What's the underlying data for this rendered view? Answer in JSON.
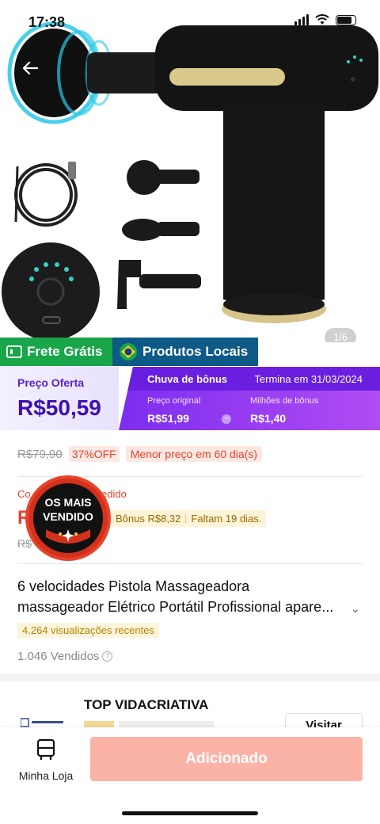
{
  "status_bar": {
    "time": "17:38"
  },
  "gallery": {
    "counter": "1/6"
  },
  "badges": {
    "free_shipping": "Frete Grátis",
    "local_products": "Produtos Locais"
  },
  "price": {
    "offer_label": "Preço Oferta",
    "offer_value": "R$50,59",
    "promo_title": "Chuva de bônus",
    "promo_ends": "Termina em 31/03/2024",
    "original_label": "Preço original",
    "original_value": "R$51,99",
    "bonus_label": "Milhões de bônus",
    "bonus_value": "R$1,40"
  },
  "discount": {
    "old_price": "R$79,90",
    "percent": "37%OFF",
    "lowest": "Menor preço em 60 dia(s)"
  },
  "coupon": {
    "label_prefix": "Co",
    "label_suffix": "edido",
    "price_prefix": "R",
    "bonus": "Bônus R$8,32",
    "remaining": "Faltam 19 dias.",
    "old_prefix": "R$"
  },
  "seal": {
    "line1": "OS MAIS",
    "line2": "VENDIDO"
  },
  "product": {
    "title_line1": "6 velocidades Pistola Massageadora",
    "title_line2": "massageador Elétrico Portátil Profissional apare...",
    "views": "4.264 visualizações recentes",
    "sold": "1.046 Vendidos"
  },
  "store": {
    "name": "TOP VIDACRIATIVA",
    "visit": "Visitar"
  },
  "bottom_bar": {
    "my_store": "Minha Loja",
    "add_button": "Adicionado"
  },
  "colors": {
    "accent_purple": "#6a1fe0",
    "discount_red": "#e8432c",
    "add_button": "#fbb3a8"
  },
  "icons": [
    "back-arrow-icon",
    "signal-icon",
    "wifi-icon",
    "battery-icon",
    "brazil-flag-icon",
    "truck-icon",
    "store-icon",
    "question-icon",
    "chevron-down-icon"
  ]
}
